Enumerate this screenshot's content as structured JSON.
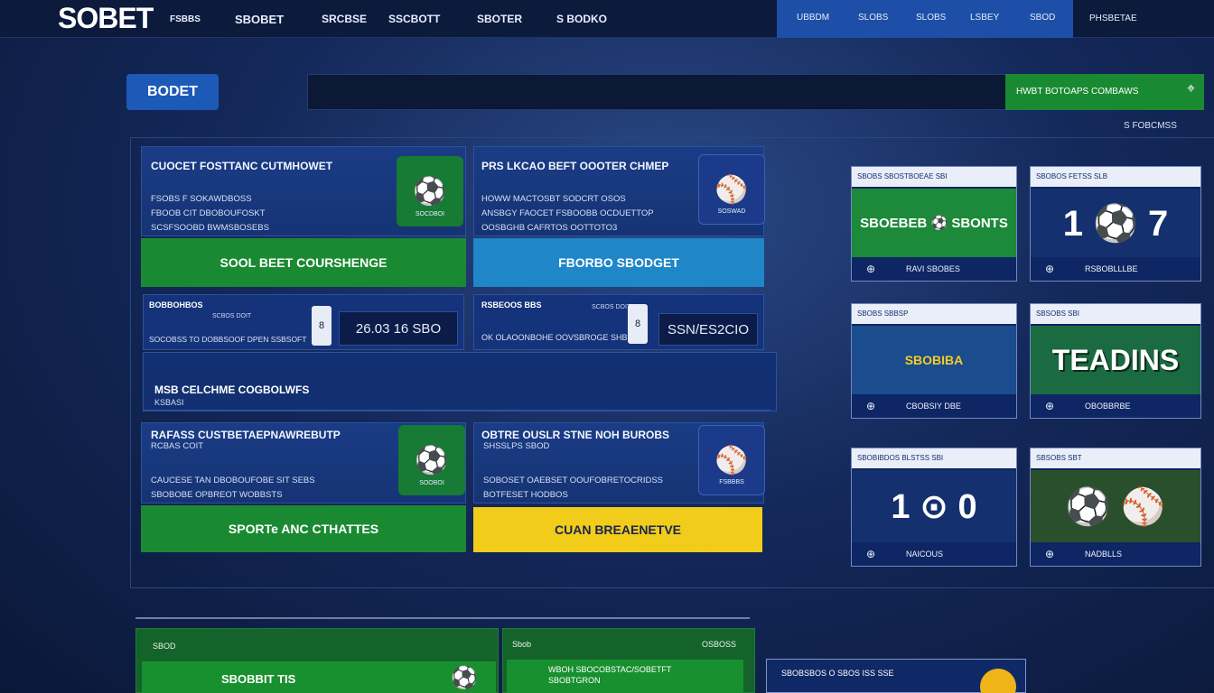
{
  "topbar": {
    "logo": "SOBET",
    "nav": [
      "FSBBS",
      "SBOBET",
      "SRCBSE",
      "SSCBOTT",
      "SBOTER",
      "S BODKO"
    ],
    "blue_nav": [
      "UBBDM",
      "SLOBS",
      "SLOBS",
      "LSBEY",
      "SBOD"
    ],
    "right_nav": "PHSBETAE"
  },
  "bar": {
    "brand": "BODET",
    "green_text": "HWBT BOTOAPS COMBAWS",
    "green_icon": "⌖",
    "tiny_right": "S FOBCMSS"
  },
  "cards": [
    {
      "title": "CUOCET FOSTTANC CUTMHOWET",
      "lines": [
        "FSOBS F SOKAWDBOSS",
        "FBOOB CIT DBOBOUFOSKT",
        "SCSFSOOBD BWMSBOSEBS"
      ],
      "tile_icon": "⚽",
      "tile_label": "SOCDBOI",
      "button": "SOOL BEET COURSHENGE"
    },
    {
      "title": "PRS LKCAO BEFT OOOTER CHMEP",
      "lines": [
        "HOWW MACTOSBT SODCRT OSOS",
        "ANSBGY FAOCET FSBOOBB OCDUETTOP",
        "OOSBGHB CAFRTOS OOTTOTO3"
      ],
      "tile_icon": "⚾",
      "tile_label": "SOSWAD",
      "button": "FBORBO SBODGET"
    },
    {
      "title": "RAFASS CUSTBETAEPNAWREBUTP",
      "sub": "RCBAS COIT",
      "lines": [
        "CAUCESE TAN DBOBOUFOBE SIT SEBS",
        "SBOBOBE OPBREOT WOBBSTS"
      ],
      "tile_icon": "⚽",
      "tile_label": "SOOBOI",
      "button": "SPORTe ANC CTHATTES"
    },
    {
      "title": "OBTRE OUSLR STNE NOH BUROBS",
      "sub": "SHSSLPS SBOD",
      "lines": [
        "SOBOSET OAEBSET OOUFOBRETOCRIDSS",
        "BOTFESET HODBOS"
      ],
      "tile_icon": "⚾",
      "tile_label": "FSBBBS",
      "button": "CUAN BREAENETVE"
    }
  ],
  "score_rows": [
    {
      "label": "BOBBOHBOS",
      "sub": "SCBOS DOIT",
      "line": "SOCOBSS TO DOBBSOOF DPEN SSBSOFT",
      "score": "26.03   16 SBO",
      "lock": "8"
    },
    {
      "label": "RSBEOOS BBS",
      "sub": "SCBOS DOIT",
      "line": "OK  OLAOONBOHE OOVSBROGE SHBEP",
      "score": "SSN/ES2CIO",
      "lock": "8"
    }
  ],
  "banner": {
    "title": "MSB CELCHME COGBOLWFS",
    "sub": "KSBASI"
  },
  "side_cards": [
    {
      "header": "SBOBS   SBOSTBOEAE   SBI",
      "body": "SBOEBEB  ⚽  SBONTS",
      "footer": "RAVI SBOBES",
      "icon": "⊕"
    },
    {
      "header": "SBOBOS FETSS   SLB",
      "body": "1   ⚽   7",
      "footer": "RSBOBLLLBE",
      "icon": "⊕"
    },
    {
      "header": "SBOBS   SBBSP",
      "body": "SBOBIBA",
      "footer": "CBOBSIY DBE",
      "icon": "⊕"
    },
    {
      "header": "SBSOBS   SBI",
      "body": "TEADINS",
      "footer": "OBOBBRBE",
      "icon": "⊕"
    },
    {
      "header": "SBOBIBDOS BLSTSS   SBI",
      "body": "1   ⊙   0",
      "footer": "NAICOUS",
      "icon": "⊕"
    },
    {
      "header": "SBSOBS   SBT",
      "body": "⚽  ⚾",
      "footer": "NADBLLS",
      "icon": "⊕"
    }
  ],
  "bottom": {
    "card1_label": "SBOD",
    "card1_title": "SBOBBIT TIS",
    "card1_icon": "⚽",
    "card2_label": "Sbob",
    "card2_right": "OSBOSS",
    "card2_lines": [
      "WBOH SBOCOBSTAC/SOBETFT",
      "SBOBTGRON"
    ],
    "side_text": "SBOBSBOS O  SBOS  ISS SSE"
  }
}
